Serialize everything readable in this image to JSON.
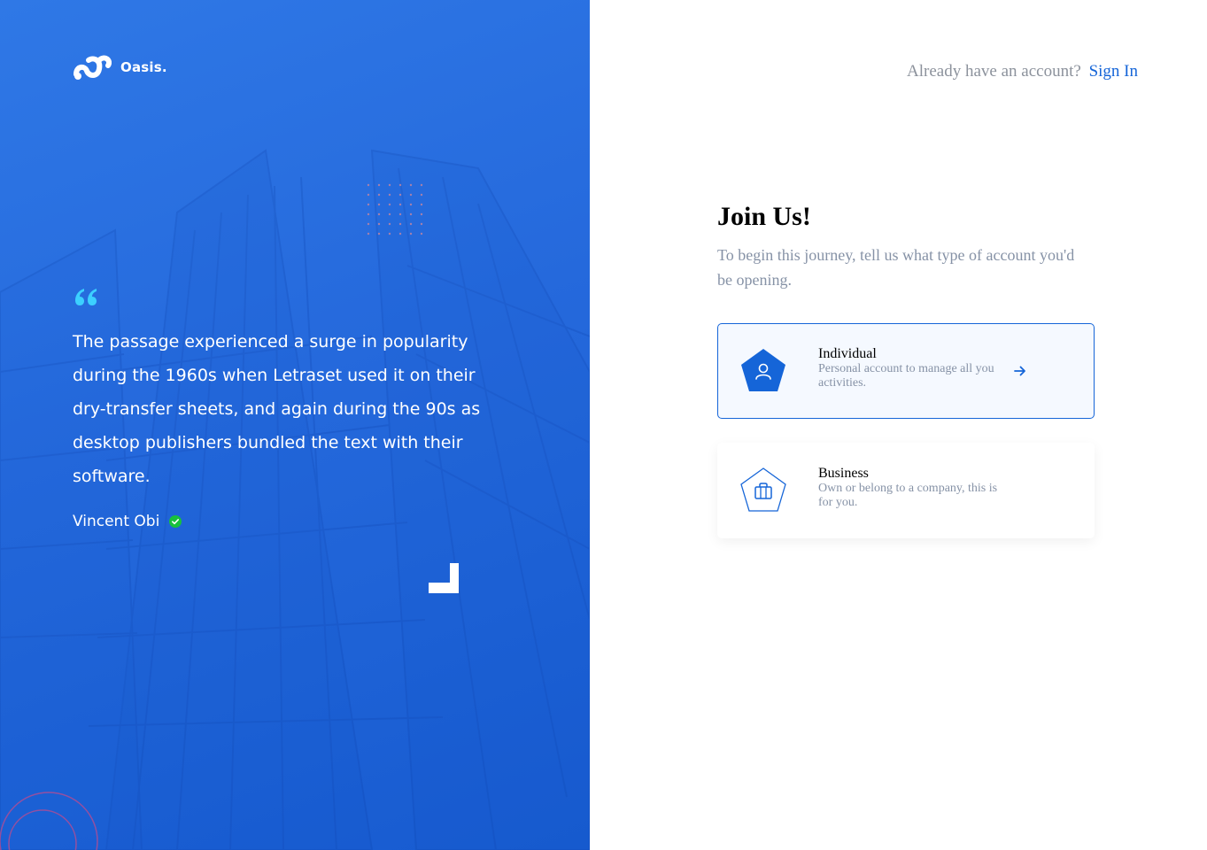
{
  "brand": {
    "name": "Oasis."
  },
  "hero": {
    "quote": "The passage experienced a surge in popularity during the 1960s when Letraset used it on their dry-transfer sheets, and again during the 90s as desktop publishers bundled the text with their software.",
    "author": "Vincent Obi"
  },
  "auth": {
    "prompt": "Already have an account?",
    "signin_label": "Sign In"
  },
  "main": {
    "title": "Join Us!",
    "subtitle": "To begin this journey, tell us what type of account you'd be opening."
  },
  "account_types": [
    {
      "title": "Individual",
      "description": "Personal account to manage all you activities.",
      "icon": "user-icon",
      "selected": true
    },
    {
      "title": "Business",
      "description": "Own or belong to a company, this is for you.",
      "icon": "briefcase-icon",
      "selected": false
    }
  ],
  "colors": {
    "primary": "#1565d8",
    "hero_blue": "#2569dc",
    "muted_text": "#8692a6",
    "verified_green": "#18c13c",
    "quote_cyan": "#3cd0ff"
  }
}
